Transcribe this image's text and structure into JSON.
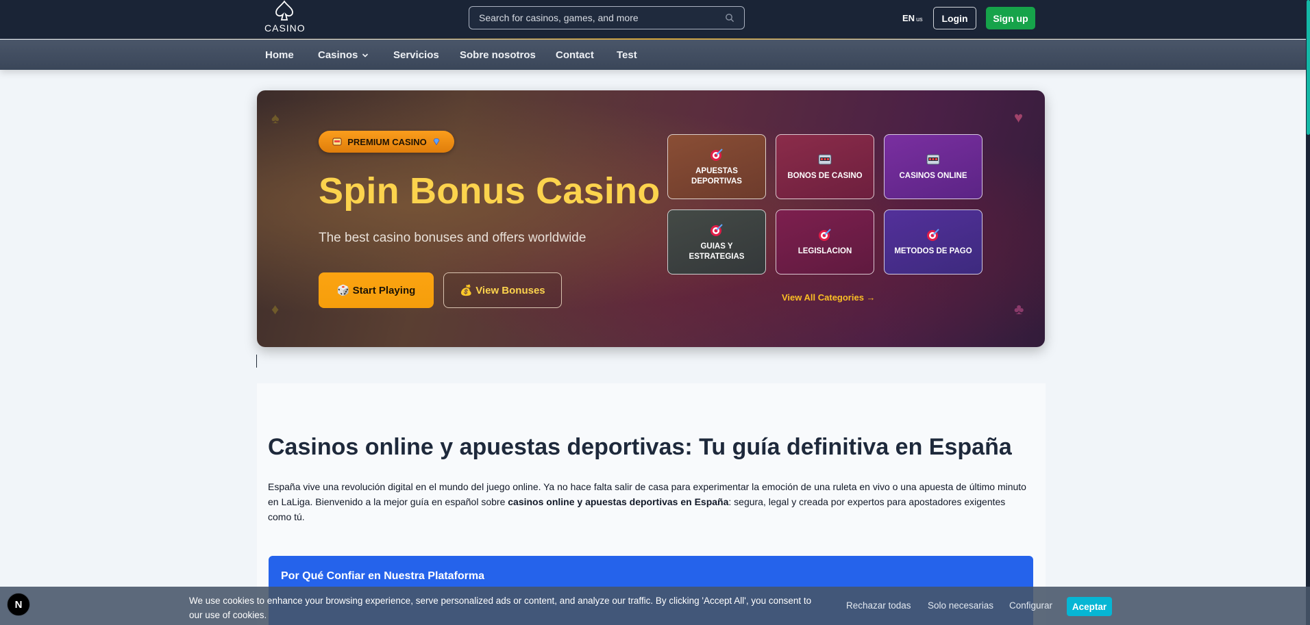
{
  "header": {
    "logo_text": "CASINO",
    "search_placeholder": "Search for casinos, games, and more",
    "lang": "EN",
    "lang_region": "us",
    "login_label": "Login",
    "signup_label": "Sign up"
  },
  "nav": {
    "items": [
      {
        "label": "Home"
      },
      {
        "label": "Casinos"
      },
      {
        "label": "Servicios"
      },
      {
        "label": "Sobre nosotros"
      },
      {
        "label": "Contact"
      },
      {
        "label": "Test"
      }
    ]
  },
  "hero": {
    "badge_label": "PREMIUM CASINO",
    "title": "Spin Bonus Casino",
    "subtitle": "The best casino bonuses and offers worldwide",
    "start_label": "Start Playing",
    "view_label": "View Bonuses",
    "view_all_label": "View All Categories →",
    "categories": [
      {
        "label": "APUESTAS DEPORTIVAS",
        "icon": "target-icon",
        "color": "#7a4532"
      },
      {
        "label": "BONOS DE CASINO",
        "icon": "slot-machine-icon",
        "color": "#7a2345"
      },
      {
        "label": "CASINOS ONLINE",
        "icon": "slot-machine-icon",
        "color": "#6a2a8c"
      },
      {
        "label": "GUIAS Y ESTRATEGIAS",
        "icon": "target-icon",
        "color": "#3b3f3c"
      },
      {
        "label": "LEGISLACION",
        "icon": "target-icon",
        "color": "#6d1d45"
      },
      {
        "label": "METODOS DE PAGO",
        "icon": "target-icon",
        "color": "#4a2a86"
      }
    ]
  },
  "content": {
    "title": "Casinos online y apuestas deportivas: Tu guía definitiva en España",
    "para_part1": "España vive una revolución digital en el mundo del juego online. Ya no hace falta salir de casa para experimentar la emoción de una ruleta en vivo o una apuesta de último minuto en LaLiga. Bienvenido a la mejor guía en español sobre ",
    "para_bold": "casinos online y apuestas deportivas en España",
    "para_part2": ": segura, legal y creada por expertos para apostadores exigentes como tú.",
    "trust_title": "Por Qué Confiar en Nuestra Plataforma"
  },
  "cookie": {
    "text": "We use cookies to enhance your browsing experience, serve personalized ads or content, and analyze our traffic. By clicking 'Accept All', you consent to our use of cookies.",
    "reject_label": "Rechazar todas",
    "necessary_label": "Solo necesarias",
    "configure_label": "Configurar",
    "accept_label": "Aceptar"
  },
  "dev_badge": "N",
  "colors": {
    "header_bg": "#1a2436",
    "signup_green": "#16a34a",
    "hero_title": "#fcd34d",
    "accent_orange": "#f59e0b",
    "trust_blue": "#2563eb",
    "accept_cyan": "#06b6d4"
  }
}
